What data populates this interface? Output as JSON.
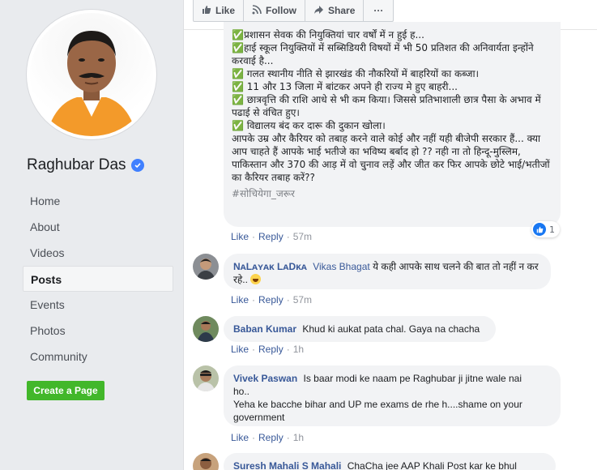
{
  "profile": {
    "name": "Raghubar Das",
    "nav": [
      "Home",
      "About",
      "Videos",
      "Posts",
      "Events",
      "Photos",
      "Community"
    ],
    "active_nav": "Posts",
    "create_page_label": "Create a Page"
  },
  "actions": {
    "like": "Like",
    "follow": "Follow",
    "share": "Share",
    "more": "···"
  },
  "post": {
    "lines": [
      "✅प्रशासन सेवक की नियुक्तियां चार वर्षों में न हुई ह...",
      "",
      "✅हाई स्कूल नियुक्तियों में सब्सिडियरी विषयों में भी 50 प्रतिशत की अनिवार्यता इन्होंने करवाई है...",
      "✅ गलत स्थानीय नीति से झारखंड की नौकरियों में बाहरियों का कब्जा।",
      "✅ 11 और 13 जिला में बांटकर अपने ही राज्य मे हुए बाहरी...",
      "✅ छात्रवृत्ति की राशि आधे से भी कम किया। जिससे प्रतिभाशाली छात्र पैसा के अभाव में पढाई से वंचित हुए।",
      "✅ विद्यालय बंद कर दारू की दुकान खोला।",
      "",
      "आपके उम्र और कैरियर को तबाह करने वाले कोई और नहीं यही बीजेपी सरकार हैं... क्या आप चाहते हैं आपके भाई भतीजे का भविष्य बर्बाद हो ?? नही ना तो हिन्दू-मुस्लिम, पाकिस्तान और 370 की आड़ में वो चुनाव लड़ें और जीत कर फिर आपके छोटे भाई/भतीजों का कैरियर तबाह करें??"
    ],
    "hashtag": "#सोचियेगा_जरूर",
    "reaction_count": "1",
    "meta": {
      "like": "Like",
      "reply": "Reply",
      "time": "57m"
    }
  },
  "comments": [
    {
      "author": "NᴀLᴀʏᴀᴋ LᴀDᴋᴀ",
      "tagged": "Vikas Bhagat",
      "text": "ये कही आपके साथ चलने की बात तो नहीं न कर रहे..",
      "like": "Like",
      "reply": "Reply",
      "time": "57m"
    },
    {
      "author": "Baban Kumar",
      "text": "Khud ki aukat pata chal. Gaya na chacha",
      "like": "Like",
      "reply": "Reply",
      "time": "1h"
    },
    {
      "author": "Vivek Paswan",
      "text_line1": "Is baar modi ke naam pe Raghubar ji jitne wale nai",
      "text_line2": "ho..",
      "text_line3": "Yeha ke bacche bihar and UP me exams de rhe h....shame on your",
      "text_line4": "government",
      "like": "Like",
      "reply": "Reply",
      "time": "1h"
    },
    {
      "author": "Suresh Mahali S Mahali",
      "text": "ChaCha jee AAP Khali Post kar ke bhul"
    }
  ]
}
